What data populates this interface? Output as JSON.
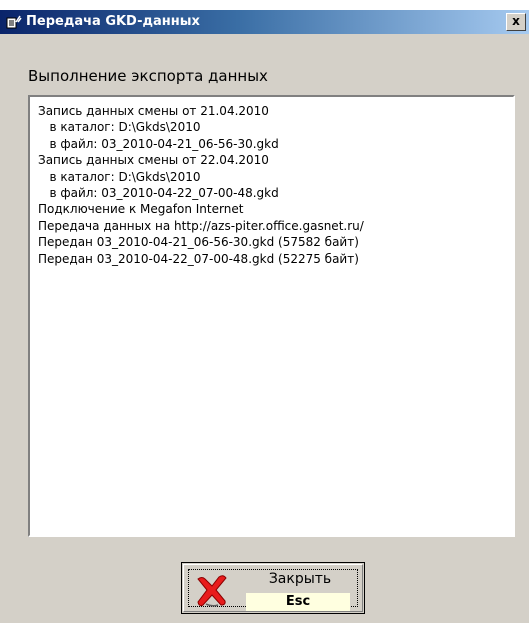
{
  "window": {
    "title": "Передача GKD-данных",
    "close_glyph": "x"
  },
  "main": {
    "header": "Выполнение экспорта данных",
    "log_lines": [
      "Запись данных смены от 21.04.2010",
      "   в каталог: D:\\Gkds\\2010",
      "   в файл: 03_2010-04-21_06-56-30.gkd",
      "Запись данных смены от 22.04.2010",
      "   в каталог: D:\\Gkds\\2010",
      "   в файл: 03_2010-04-22_07-00-48.gkd",
      "Подключение к Megafon Internet",
      "Передача данных на http://azs-piter.office.gasnet.ru/",
      "Передан 03_2010-04-21_06-56-30.gkd (57582 байт)",
      "Передан 03_2010-04-22_07-00-48.gkd (52275 байт)"
    ]
  },
  "close_button": {
    "label": "Закрыть",
    "shortcut": "Esc",
    "icon": "red-x-icon"
  },
  "colors": {
    "titlebar_start": "#0a246a",
    "titlebar_end": "#a6caf0",
    "dialog_bg": "#d4d0c8",
    "shortcut_bg": "#ffffe0",
    "x_icon": "#e81c1c"
  }
}
